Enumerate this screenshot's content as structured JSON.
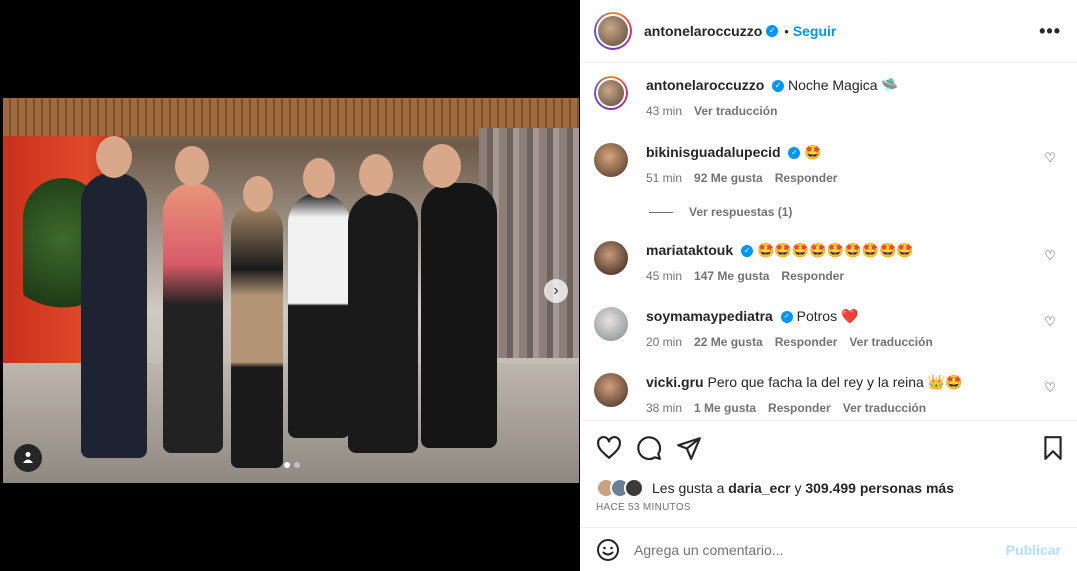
{
  "post": {
    "username": "antonelaroccuzzo",
    "follow_label": "Seguir",
    "separator": "•",
    "more_label": "•••"
  },
  "caption": {
    "username": "antonelaroccuzzo",
    "text": "Noche Magica",
    "emoji": "🛸",
    "time": "43 min",
    "translate": "Ver traducción"
  },
  "comments": [
    {
      "username": "bikinisguadalupecid",
      "verified": true,
      "text": "",
      "emoji": "🤩",
      "time": "51 min",
      "likes": "92 Me gusta",
      "reply": "Responder",
      "translate": ""
    },
    {
      "username": "mariataktouk",
      "verified": true,
      "text": "",
      "emoji": "🤩🤩🤩🤩🤩🤩🤩🤩🤩",
      "time": "45 min",
      "likes": "147 Me gusta",
      "reply": "Responder",
      "translate": ""
    },
    {
      "username": "soymamaypediatra",
      "verified": true,
      "text": "Potros",
      "emoji": "❤️",
      "time": "20 min",
      "likes": "22 Me gusta",
      "reply": "Responder",
      "translate": "Ver traducción"
    },
    {
      "username": "vicki.gru",
      "verified": false,
      "text": "Pero que facha la del rey y la reina",
      "emoji": "👑🤩",
      "time": "38 min",
      "likes": "1 Me gusta",
      "reply": "Responder",
      "translate": "Ver traducción"
    }
  ],
  "view_replies": "Ver respuestas (1)",
  "likes": {
    "prefix": "Les gusta a",
    "user": "daria_ecr",
    "connector": "y",
    "count": "309.499 personas más"
  },
  "time_ago": "HACE 53 MINUTOS",
  "add_comment": {
    "placeholder": "Agrega un comentario...",
    "publish": "Publicar"
  },
  "icons": {
    "verified": "verified-badge-icon",
    "like": "heart-icon",
    "comment": "comment-bubble-icon",
    "share": "paper-plane-icon",
    "save": "bookmark-icon",
    "emoji": "smiley-icon",
    "next": "chevron-right-icon",
    "tag": "user-tag-icon"
  },
  "colors": {
    "accent": "#0095f6",
    "muted": "#737373",
    "publish_disabled": "#b2dffc"
  }
}
